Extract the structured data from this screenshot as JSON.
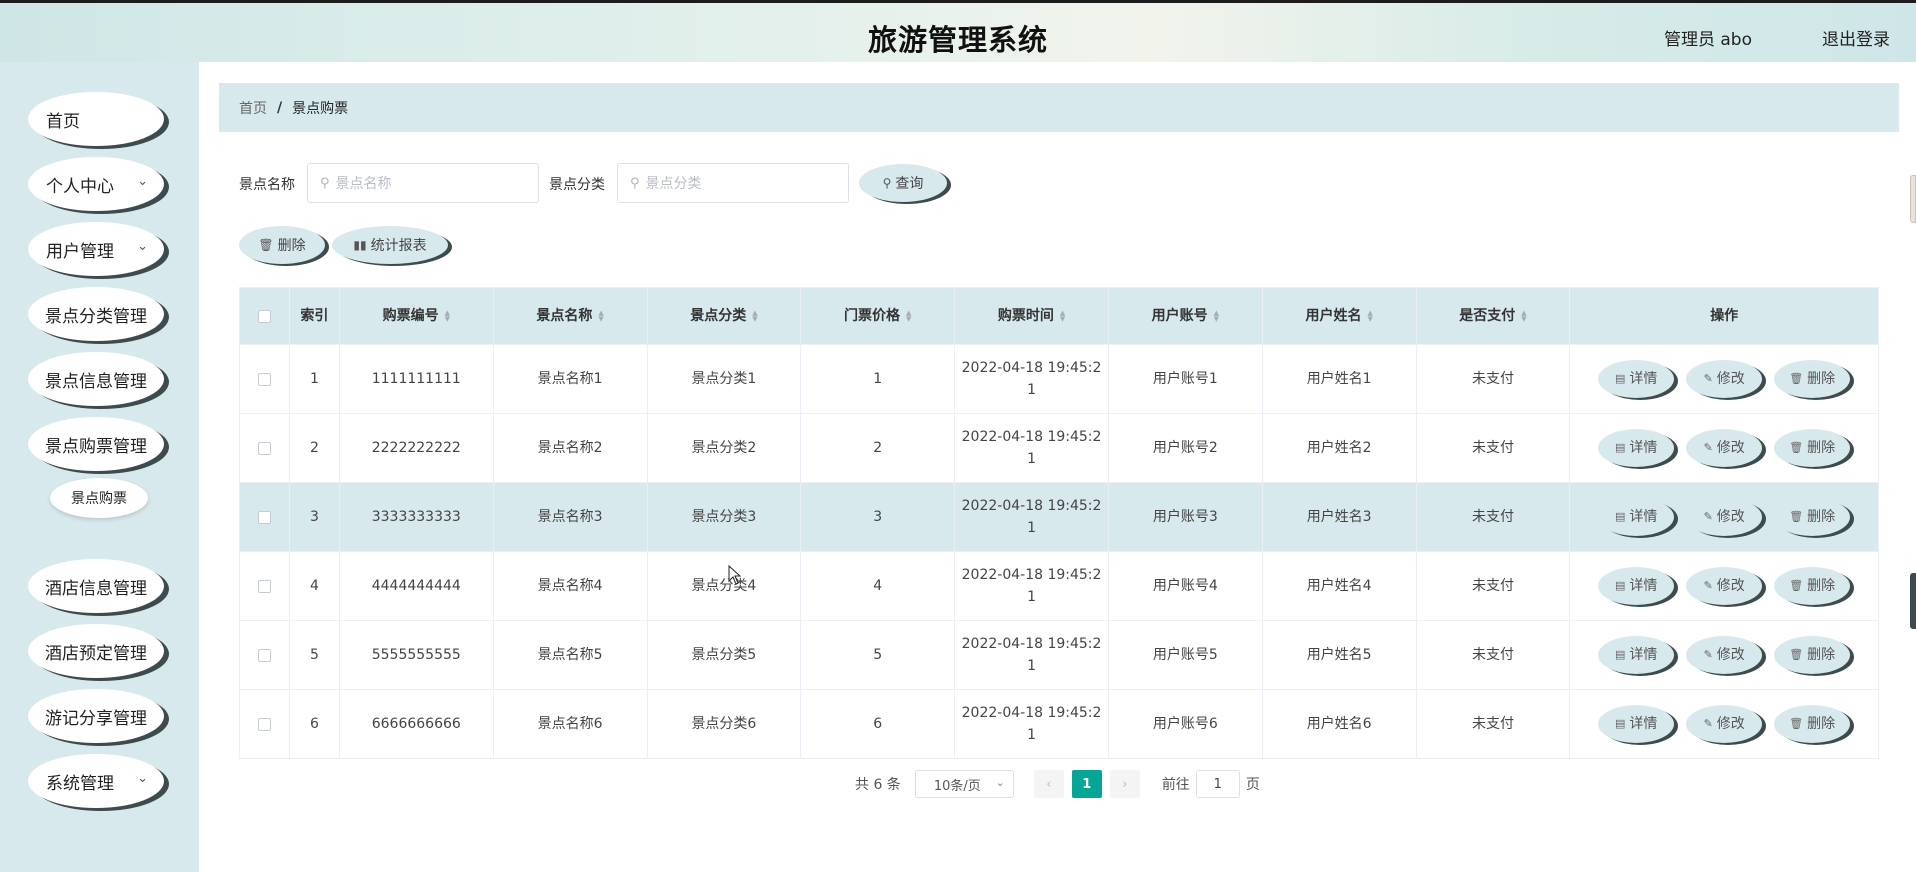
{
  "header": {
    "title": "旅游管理系统",
    "user": "管理员 abo",
    "logout": "退出登录"
  },
  "sidebar": {
    "items": [
      {
        "label": "首页",
        "chevron": false
      },
      {
        "label": "个人中心",
        "chevron": true
      },
      {
        "label": "用户管理",
        "chevron": true
      },
      {
        "label": "景点分类管理",
        "chevron": false
      },
      {
        "label": "景点信息管理",
        "chevron": false
      },
      {
        "label": "景点购票管理",
        "chevron": false
      },
      {
        "label": "酒店信息管理",
        "chevron": false
      },
      {
        "label": "酒店预定管理",
        "chevron": false
      },
      {
        "label": "游记分享管理",
        "chevron": false
      },
      {
        "label": "系统管理",
        "chevron": true
      }
    ],
    "sub_item": "景点购票",
    "chevron_glyph": "⌄"
  },
  "breadcrumb": {
    "home": "首页",
    "separator": "/",
    "current": "景点购票"
  },
  "search": {
    "name_label": "景点名称",
    "name_placeholder": "景点名称",
    "cat_label": "景点分类",
    "cat_placeholder": "景点分类",
    "query_label": "查询",
    "search_icon": "⚲"
  },
  "actions": {
    "delete_label": "删除",
    "report_label": "统计报表"
  },
  "table": {
    "headers": [
      "索引",
      "购票编号",
      "景点名称",
      "景点分类",
      "门票价格",
      "购票时间",
      "用户账号",
      "用户姓名",
      "是否支付",
      "操作"
    ],
    "rows": [
      {
        "idx": "1",
        "no": "1111111111",
        "name": "景点名称1",
        "cat": "景点分类1",
        "price": "1",
        "time": "2022-04-18 19:45:21",
        "account": "用户账号1",
        "uname": "用户姓名1",
        "paid": "未支付"
      },
      {
        "idx": "2",
        "no": "2222222222",
        "name": "景点名称2",
        "cat": "景点分类2",
        "price": "2",
        "time": "2022-04-18 19:45:21",
        "account": "用户账号2",
        "uname": "用户姓名2",
        "paid": "未支付"
      },
      {
        "idx": "3",
        "no": "3333333333",
        "name": "景点名称3",
        "cat": "景点分类3",
        "price": "3",
        "time": "2022-04-18 19:45:21",
        "account": "用户账号3",
        "uname": "用户姓名3",
        "paid": "未支付"
      },
      {
        "idx": "4",
        "no": "4444444444",
        "name": "景点名称4",
        "cat": "景点分类4",
        "price": "4",
        "time": "2022-04-18 19:45:21",
        "account": "用户账号4",
        "uname": "用户姓名4",
        "paid": "未支付"
      },
      {
        "idx": "5",
        "no": "5555555555",
        "name": "景点名称5",
        "cat": "景点分类5",
        "price": "5",
        "time": "2022-04-18 19:45:21",
        "account": "用户账号5",
        "uname": "用户姓名5",
        "paid": "未支付"
      },
      {
        "idx": "6",
        "no": "6666666666",
        "name": "景点名称6",
        "cat": "景点分类6",
        "price": "6",
        "time": "2022-04-18 19:45:21",
        "account": "用户账号6",
        "uname": "用户姓名6",
        "paid": "未支付"
      }
    ],
    "row_actions": {
      "detail": "详情",
      "edit": "修改",
      "delete": "删除"
    },
    "highlighted_row": 3
  },
  "pagination": {
    "total": "共 6 条",
    "page_size": "10条/页",
    "current_page": "1",
    "goto_prefix": "前往",
    "goto_value": "1",
    "goto_suffix": "页",
    "prev_icon": "‹",
    "next_icon": "›"
  },
  "colors": {
    "accent": "#06a594",
    "panel": "#d8e9ee",
    "pill_shadow": "#3d4b4d"
  }
}
